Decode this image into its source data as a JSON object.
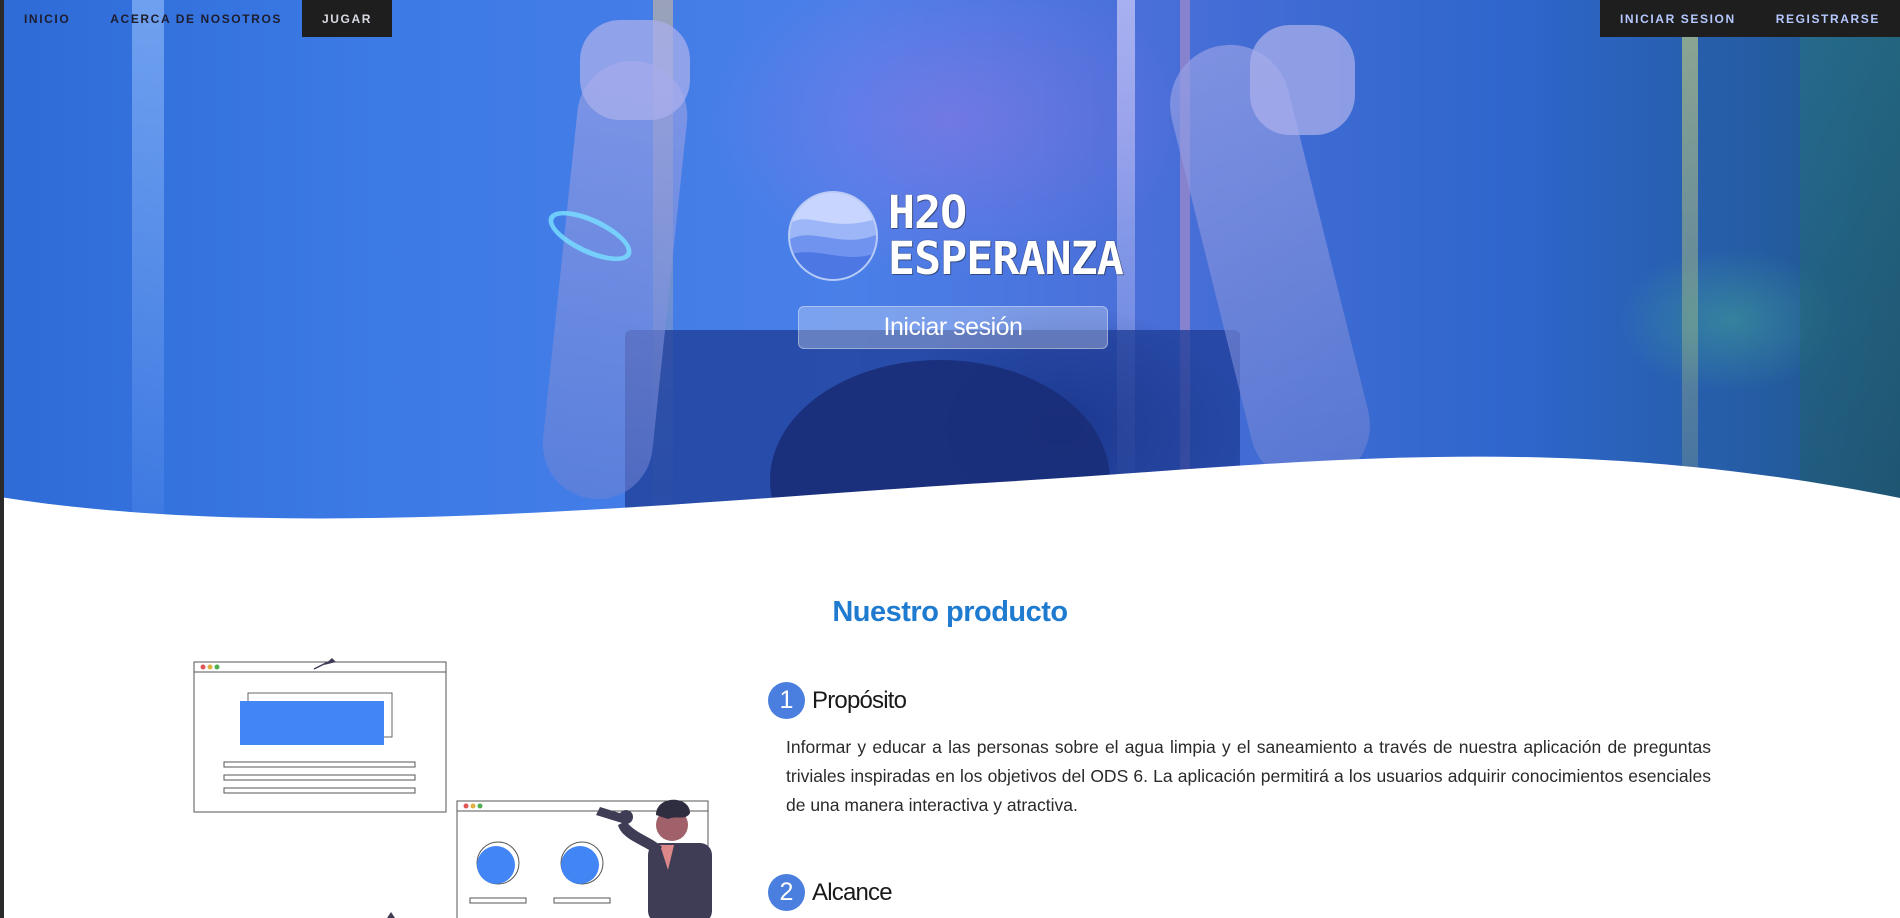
{
  "nav": {
    "left": [
      {
        "label": "INICIO"
      },
      {
        "label": "ACERCA DE NOSOTROS"
      },
      {
        "label": "JUGAR"
      }
    ],
    "right": [
      {
        "label": "INICIAR SESION"
      },
      {
        "label": "REGISTRARSE"
      }
    ]
  },
  "hero": {
    "logo_line1": "H2O",
    "logo_line2": "ESPERANZA",
    "login_button": "Iniciar sesión"
  },
  "product": {
    "title": "Nuestro producto",
    "steps": [
      {
        "number": "1",
        "title": "Propósito",
        "description": "Informar y educar a las personas sobre el agua limpia y el saneamiento a través de nuestra aplicación de preguntas triviales inspiradas en los objetivos del ODS 6. La aplicación permitirá a los usuarios adquirir conocimientos esenciales de una manera interactiva y atractiva."
      },
      {
        "number": "2",
        "title": "Alcance"
      }
    ]
  },
  "colors": {
    "accent": "#1f7bd0",
    "step_badge": "#4a7fe0",
    "nav_dark": "#1e1e1e",
    "illustration_blue": "#4285f4"
  }
}
